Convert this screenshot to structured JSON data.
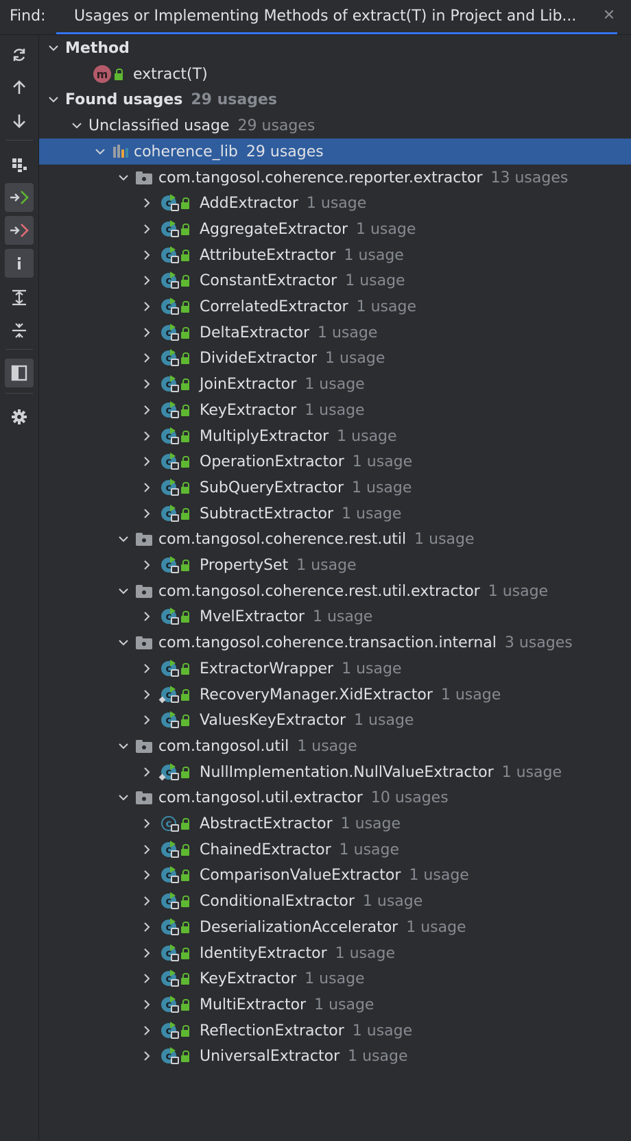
{
  "header": {
    "find_label": "Find:",
    "tab_title": "Usages or Implementing Methods of extract(T) in Project and Lib...",
    "close_glyph": "✕"
  },
  "toolbar": [
    {
      "name": "rerun-icon",
      "active": false
    },
    {
      "name": "previous-occurrence-icon",
      "active": false
    },
    {
      "name": "next-occurrence-icon",
      "active": false
    },
    {
      "name": "group-by-icon",
      "active": false
    },
    {
      "name": "show-read-access-icon",
      "active": true
    },
    {
      "name": "show-write-access-icon",
      "active": true
    },
    {
      "name": "info-icon",
      "active": true
    },
    {
      "name": "expand-all-icon",
      "active": false
    },
    {
      "name": "collapse-all-icon",
      "active": false
    },
    {
      "name": "preview-icon",
      "active": true
    },
    {
      "name": "settings-icon",
      "active": false
    }
  ],
  "tree": {
    "method_header": "Method",
    "method_name": "extract(T)",
    "found_usages": "Found usages",
    "found_usages_count": "29 usages",
    "unclassified": "Unclassified usage",
    "unclassified_count": "29 usages",
    "library": "coherence_lib",
    "library_count": "29 usages",
    "packages": [
      {
        "name": "com.tangosol.coherence.reporter.extractor",
        "count": "13 usages",
        "classes": [
          {
            "name": "AddExtractor",
            "count": "1 usage"
          },
          {
            "name": "AggregateExtractor",
            "count": "1 usage"
          },
          {
            "name": "AttributeExtractor",
            "count": "1 usage"
          },
          {
            "name": "ConstantExtractor",
            "count": "1 usage"
          },
          {
            "name": "CorrelatedExtractor",
            "count": "1 usage"
          },
          {
            "name": "DeltaExtractor",
            "count": "1 usage"
          },
          {
            "name": "DivideExtractor",
            "count": "1 usage"
          },
          {
            "name": "JoinExtractor",
            "count": "1 usage"
          },
          {
            "name": "KeyExtractor",
            "count": "1 usage"
          },
          {
            "name": "MultiplyExtractor",
            "count": "1 usage"
          },
          {
            "name": "OperationExtractor",
            "count": "1 usage"
          },
          {
            "name": "SubQueryExtractor",
            "count": "1 usage"
          },
          {
            "name": "SubtractExtractor",
            "count": "1 usage"
          }
        ]
      },
      {
        "name": "com.tangosol.coherence.rest.util",
        "count": "1 usage",
        "classes": [
          {
            "name": "PropertySet",
            "count": "1 usage"
          }
        ]
      },
      {
        "name": "com.tangosol.coherence.rest.util.extractor",
        "count": "1 usage",
        "classes": [
          {
            "name": "MvelExtractor",
            "count": "1 usage"
          }
        ]
      },
      {
        "name": "com.tangosol.coherence.transaction.internal",
        "count": "3 usages",
        "classes": [
          {
            "name": "ExtractorWrapper",
            "count": "1 usage"
          },
          {
            "name": "RecoveryManager.XidExtractor",
            "count": "1 usage",
            "nested": true
          },
          {
            "name": "ValuesKeyExtractor",
            "count": "1 usage"
          }
        ]
      },
      {
        "name": "com.tangosol.util",
        "count": "1 usage",
        "classes": [
          {
            "name": "NullImplementation.NullValueExtractor",
            "count": "1 usage",
            "nested": true
          }
        ]
      },
      {
        "name": "com.tangosol.util.extractor",
        "count": "10 usages",
        "classes": [
          {
            "name": "AbstractExtractor",
            "count": "1 usage",
            "abstract": true
          },
          {
            "name": "ChainedExtractor",
            "count": "1 usage"
          },
          {
            "name": "ComparisonValueExtractor",
            "count": "1 usage"
          },
          {
            "name": "ConditionalExtractor",
            "count": "1 usage"
          },
          {
            "name": "DeserializationAccelerator",
            "count": "1 usage"
          },
          {
            "name": "IdentityExtractor",
            "count": "1 usage"
          },
          {
            "name": "KeyExtractor",
            "count": "1 usage"
          },
          {
            "name": "MultiExtractor",
            "count": "1 usage"
          },
          {
            "name": "ReflectionExtractor",
            "count": "1 usage"
          },
          {
            "name": "UniversalExtractor",
            "count": "1 usage"
          }
        ]
      }
    ]
  }
}
